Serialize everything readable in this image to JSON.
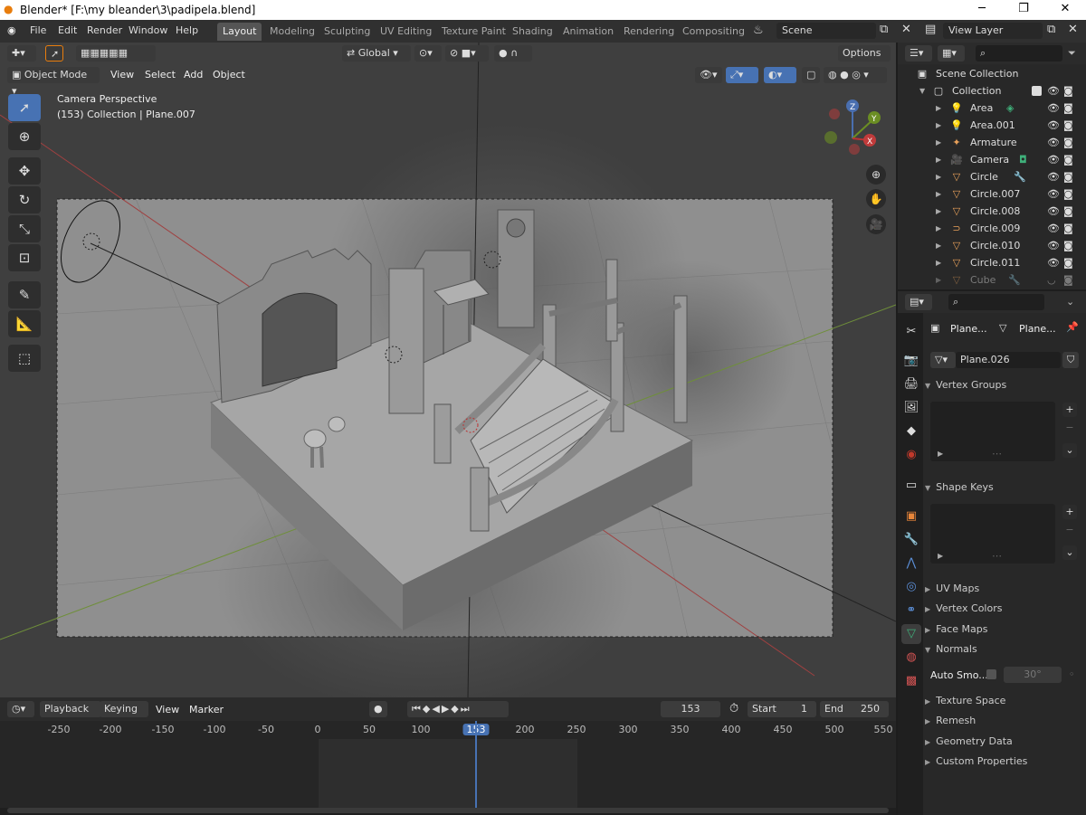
{
  "window": {
    "title": "Blender* [F:\\my bleander\\3\\padipela.blend]",
    "minimize": "─",
    "maximize": "❐",
    "close": "✕"
  },
  "topbar": {
    "menus": [
      "File",
      "Edit",
      "Render",
      "Window",
      "Help"
    ],
    "workspaces": [
      "Layout",
      "Modeling",
      "Sculpting",
      "UV Editing",
      "Texture Paint",
      "Shading",
      "Animation",
      "Rendering",
      "Compositing"
    ],
    "active_workspace": "Layout",
    "scene": "Scene",
    "view_layer": "View Layer"
  },
  "viewport": {
    "mode": "Object Mode",
    "menus": [
      "View",
      "Select",
      "Add",
      "Object"
    ],
    "transform_orientation": "Global",
    "options_label": "Options",
    "overlay_title": "Camera Perspective",
    "overlay_subtitle": "(153) Collection | Plane.007",
    "gizmo": {
      "x": "X",
      "y": "Y",
      "z": "Z"
    }
  },
  "timeline": {
    "menus": [
      "Playback",
      "Keying",
      "View",
      "Marker"
    ],
    "current_frame": "153",
    "start_label": "Start",
    "start": "1",
    "end_label": "End",
    "end": "250",
    "ruler": [
      "-250",
      "-200",
      "-150",
      "-100",
      "-50",
      "0",
      "50",
      "100",
      "153",
      "200",
      "250",
      "300",
      "350",
      "400",
      "450",
      "500",
      "550"
    ]
  },
  "outliner": {
    "root": "Scene Collection",
    "collection": "Collection",
    "items": [
      "Area",
      "Area.001",
      "Armature",
      "Camera",
      "Circle",
      "Circle.007",
      "Circle.008",
      "Circle.009",
      "Circle.010",
      "Circle.011",
      "Cube"
    ]
  },
  "properties": {
    "object_name": "Plane...",
    "data_name": "Plane...",
    "mesh_name": "Plane.026",
    "panels": {
      "vertex_groups": "Vertex Groups",
      "shape_keys": "Shape Keys",
      "uv_maps": "UV Maps",
      "vertex_colors": "Vertex Colors",
      "face_maps": "Face Maps",
      "normals": "Normals",
      "auto_smooth": "Auto Smo...",
      "angle": "30°",
      "texture_space": "Texture Space",
      "remesh": "Remesh",
      "geometry_data": "Geometry Data",
      "custom_properties": "Custom Properties"
    }
  },
  "colors": {
    "accent": "#4772b3",
    "active_tab": "#555555",
    "bg": "#303030",
    "viewport": "#3d3d3d"
  }
}
